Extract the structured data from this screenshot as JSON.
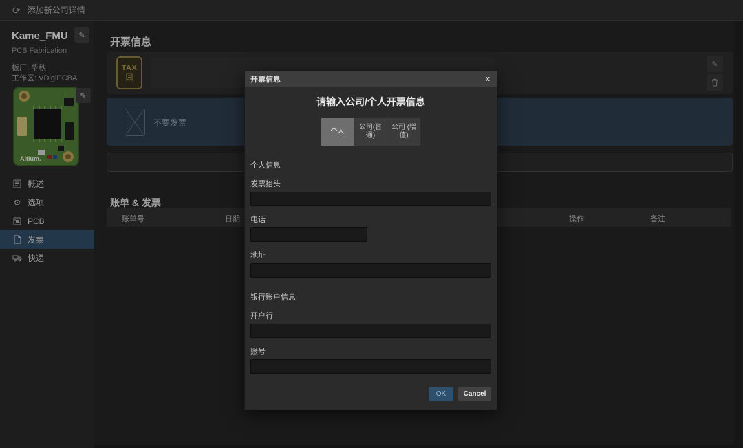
{
  "topbar": {
    "title": "添加新公司详情",
    "refresh_icon": "⟳"
  },
  "sidebar": {
    "project_name": "Kame_FMU",
    "project_type": "PCB Fabrication",
    "vendor": "板厂: 华秋",
    "workspace": "工作区: VDigiPCBA",
    "board_brand": "Altium.",
    "edit_icon": "✎",
    "items": [
      {
        "label": "概述",
        "selected": false
      },
      {
        "label": "选项",
        "selected": false
      },
      {
        "label": "PCB",
        "selected": false
      },
      {
        "label": "发票",
        "selected": true
      },
      {
        "label": "快递",
        "selected": false
      }
    ]
  },
  "main": {
    "invoice_section_title": "开票信息",
    "tax_card": {
      "icon_text": "TAX"
    },
    "no_invoice_label": "不要发票",
    "billing_section_title": "账单 & 发票",
    "table": {
      "headers": [
        "账单号",
        "日期",
        "操作",
        "备注"
      ]
    }
  },
  "modal": {
    "title": "开票信息",
    "close_label": "x",
    "heading": "请输入公司/个人开票信息",
    "tabs": [
      {
        "label": "个人",
        "selected": true
      },
      {
        "label": "公司(普通)",
        "selected": false
      },
      {
        "label": "公司 (增值)",
        "selected": false
      }
    ],
    "personal_section_label": "个人信息",
    "fields": {
      "invoice_title_label": "发票抬头",
      "invoice_title_value": "",
      "phone_label": "电话",
      "phone_value": "",
      "address_label": "地址",
      "address_value": "",
      "bank_label": "开户行",
      "bank_value": "",
      "account_label": "账号",
      "account_value": ""
    },
    "bank_section_label": "银行账户信息",
    "ok_label": "OK",
    "cancel_label": "Cancel"
  },
  "colors": {
    "sidebar_selected": "#2e4a63",
    "no_invoice_row": "#2c3b4c",
    "ok_button": "#2d506e",
    "tax_gold": "#9c8b4a"
  }
}
